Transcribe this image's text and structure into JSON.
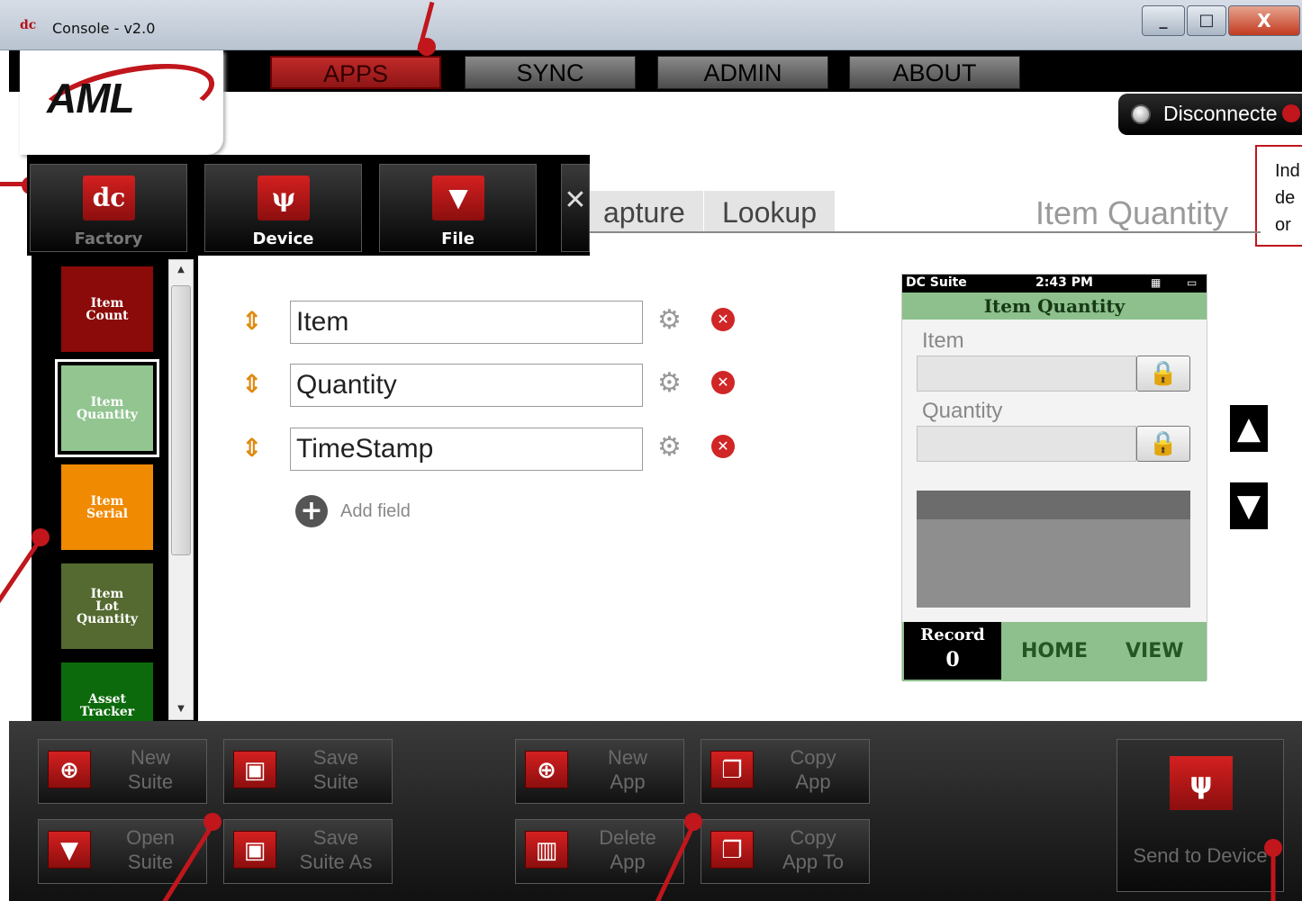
{
  "window": {
    "icon": "dc",
    "title": "Console - v2.0",
    "min": "_",
    "max": "□",
    "close": "X"
  },
  "topnav": {
    "tabs": [
      {
        "label": "APPS",
        "active": true
      },
      {
        "label": "SYNC",
        "active": false
      },
      {
        "label": "ADMIN",
        "active": false
      },
      {
        "label": "ABOUT",
        "active": false
      }
    ]
  },
  "logo": "AML",
  "connection": {
    "status": "Disconnecte",
    "tooltip_lines": [
      "Ind",
      "de",
      "or"
    ]
  },
  "source_menu": {
    "items": [
      {
        "label": "Factory",
        "icon": "dc-icon",
        "glyph": "dc"
      },
      {
        "label": "Device",
        "icon": "usb-icon",
        "glyph": "ψ"
      },
      {
        "label": "File",
        "icon": "folder-icon",
        "glyph": "▼"
      }
    ],
    "close": "✕"
  },
  "page_tabs": [
    "apture",
    "Lookup"
  ],
  "app_title": "Item Quantity",
  "sidebar": {
    "apps": [
      {
        "label": "Item\nCount",
        "color": "#8b0a0a"
      },
      {
        "label": "Item\nQuantity",
        "color": "#92c590"
      },
      {
        "label": "Item\nSerial",
        "color": "#f08a00"
      },
      {
        "label": "Item\nLot\nQuantity",
        "color": "#546a30"
      },
      {
        "label": "Asset\nTracker",
        "color": "#0c6a0c"
      }
    ]
  },
  "fields": [
    {
      "value": "Item"
    },
    {
      "value": "Quantity"
    },
    {
      "value": "TimeStamp"
    }
  ],
  "add_field_label": "Add field",
  "device_preview": {
    "app_name": "DC Suite",
    "time": "2:43 PM",
    "title": "Item Quantity",
    "labels": [
      "Item",
      "Quantity"
    ],
    "record_label": "Record",
    "record_count": "0",
    "home": "HOME",
    "view": "VIEW"
  },
  "toolbar": {
    "buttons": [
      {
        "label": "New\nSuite",
        "icon": "plus-circle-icon",
        "glyph": "⊕"
      },
      {
        "label": "Save\nSuite",
        "icon": "save-icon",
        "glyph": "▣"
      },
      {
        "label": "Open\nSuite",
        "icon": "folder-open-icon",
        "glyph": "▼"
      },
      {
        "label": "Save\nSuite As",
        "icon": "save-as-icon",
        "glyph": "▣"
      },
      {
        "label": "New\nApp",
        "icon": "plus-circle-icon",
        "glyph": "⊕"
      },
      {
        "label": "Copy\nApp",
        "icon": "copy-icon",
        "glyph": "❐"
      },
      {
        "label": "Delete\nApp",
        "icon": "trash-icon",
        "glyph": "▥"
      },
      {
        "label": "Copy\nApp To",
        "icon": "copy-to-icon",
        "glyph": "❐"
      }
    ],
    "send_label": "Send to Device",
    "send_glyph": "ψ"
  },
  "colors": {
    "accent_red": "#c0161c",
    "green_screen": "#8dc08c"
  }
}
